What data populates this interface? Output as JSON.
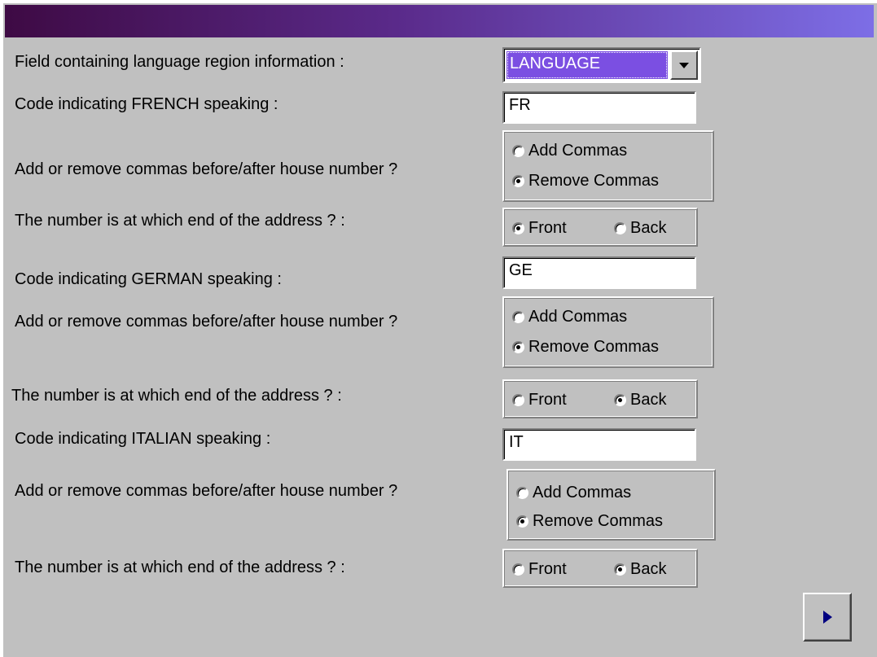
{
  "language_field": {
    "label": "Field containing language region information :",
    "value": "LANGUAGE"
  },
  "sections": [
    {
      "code_label": "Code indicating FRENCH speaking :",
      "code_value": "FR",
      "commas_label": "Add or remove commas before/after house number ?",
      "add_commas": "Add Commas",
      "remove_commas": "Remove Commas",
      "commas_selected": "Remove Commas",
      "position_label": "The number is at which end of the address ? :",
      "front": "Front",
      "back": "Back",
      "position_selected": "Front"
    },
    {
      "code_label": "Code indicating GERMAN speaking :",
      "code_value": "GE",
      "commas_label": "Add or remove commas before/after house number ?",
      "add_commas": "Add Commas",
      "remove_commas": "Remove Commas",
      "commas_selected": "Remove Commas",
      "position_label": "The number is at which end of the address ? :",
      "front": "Front",
      "back": "Back",
      "position_selected": "Back"
    },
    {
      "code_label": "Code indicating ITALIAN speaking :",
      "code_value": "IT",
      "commas_label": "Add or remove commas before/after house number ?",
      "add_commas": "Add Commas",
      "remove_commas": "Remove Commas",
      "commas_selected": "Remove Commas",
      "position_label": "The number is at which end of the address ? :",
      "front": "Front",
      "back": "Back",
      "position_selected": "Back"
    }
  ],
  "next_button": {
    "icon": "play-arrow-icon"
  },
  "colors": {
    "background": "#c0c0c0",
    "title_gradient_start": "#3e0a44",
    "title_gradient_end": "#7d6ee6",
    "selection": "#7b4fe2",
    "next_arrow": "#000080"
  }
}
